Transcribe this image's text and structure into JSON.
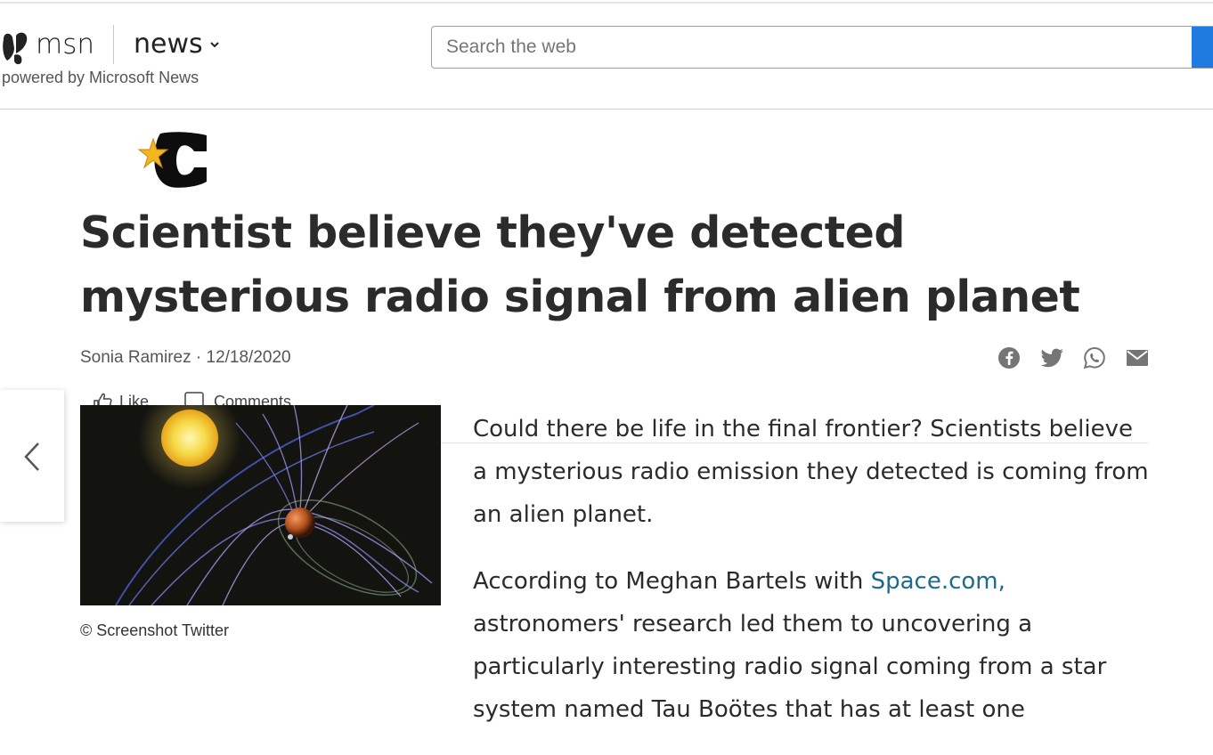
{
  "header": {
    "brand": "msn",
    "section": "news",
    "powered_by": "powered by Microsoft News",
    "search_placeholder": "Search the web",
    "accent_color": "#1f7be0"
  },
  "article": {
    "headline": "Scientist believe they've detected mysterious radio signal from alien planet",
    "author": "Sonia Ramirez",
    "separator": " · ",
    "date": "12/18/2020",
    "actions": {
      "like": "Like",
      "comments": "Comments"
    },
    "share_icons": [
      "facebook-icon",
      "twitter-icon",
      "whatsapp-icon",
      "mail-icon"
    ],
    "image_caption": "© Screenshot Twitter",
    "paragraph1": "Could there be life in the final frontier? Scientists believe a mysterious radio emission they detected is coming from an alien planet.",
    "paragraph2_before": "According to Meghan Bartels with ",
    "paragraph2_link": "Space.com,",
    "paragraph2_after": " astronomers' research led them to uncovering a particularly interesting radio signal coming from a star system named Tau Boötes that has at least one",
    "link_color": "#1e6a8a"
  },
  "nav": {
    "prev_icon": "chevron-left-icon"
  }
}
